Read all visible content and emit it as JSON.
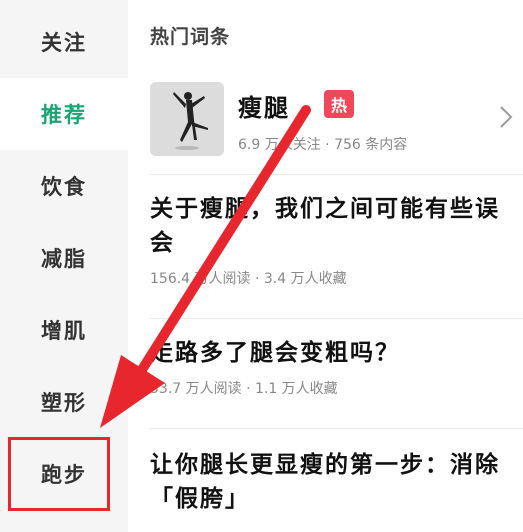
{
  "sidebar": {
    "items": [
      {
        "label": "关注"
      },
      {
        "label": "推荐"
      },
      {
        "label": "饮食"
      },
      {
        "label": "减脂"
      },
      {
        "label": "增肌"
      },
      {
        "label": "塑形"
      },
      {
        "label": "跑步"
      }
    ],
    "active_index": 1,
    "highlighted_index": 6
  },
  "main": {
    "section_title": "热门词条",
    "topic": {
      "name": "瘦腿",
      "badge": "热",
      "meta": "6.9 万人关注 · 756 条内容"
    },
    "articles": [
      {
        "title": "关于瘦腿，我们之间可能有些误会",
        "meta": "156.4 万人阅读 · 3.4 万人收藏"
      },
      {
        "title": "走路多了腿会变粗吗？",
        "meta": "53.7 万人阅读 · 1.1 万人收藏"
      },
      {
        "title": "让你腿长更显瘦的第一步：消除「假胯」",
        "meta": ""
      }
    ]
  },
  "colors": {
    "accent": "#1aa373",
    "annotation_red": "#e8262d",
    "hot_badge": "#f0475a"
  }
}
